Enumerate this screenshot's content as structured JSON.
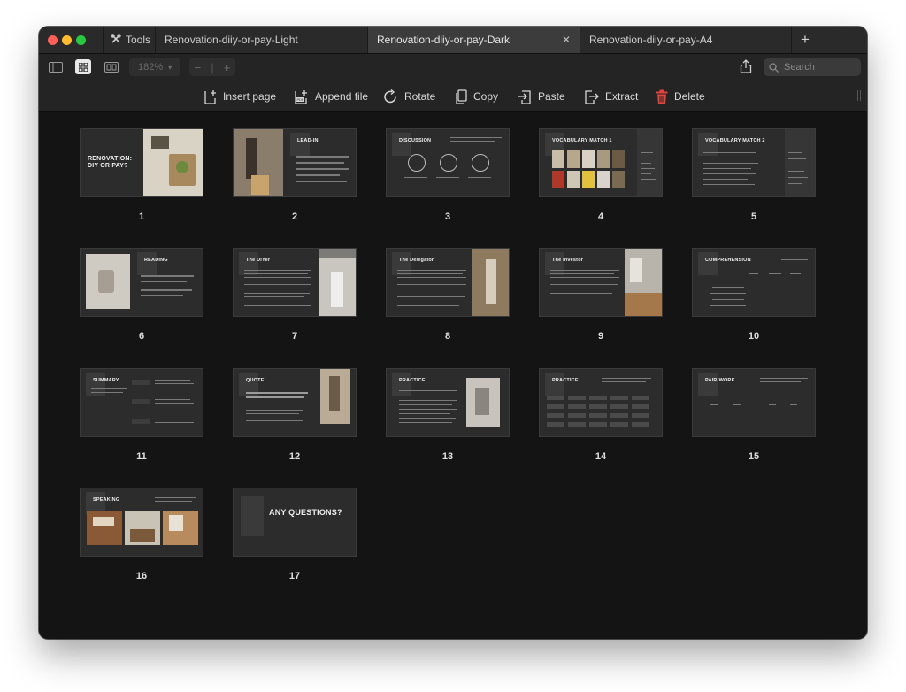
{
  "tabs": {
    "tools_label": "Tools",
    "items": [
      {
        "label": "Renovation-diiy-or-pay-Light"
      },
      {
        "label": "Renovation-diiy-or-pay-Dark"
      },
      {
        "label": "Renovation-diiy-or-pay-A4"
      }
    ],
    "close_glyph": "✕",
    "new_tab_glyph": "+"
  },
  "toolbar": {
    "zoom": "182%",
    "zoom_minus": "−",
    "zoom_plus": "+",
    "search_placeholder": "Search"
  },
  "actions": [
    {
      "label": "Insert page",
      "icon": "insert-page-icon"
    },
    {
      "label": "Append file",
      "icon": "append-pdf-icon"
    },
    {
      "label": "Rotate",
      "icon": "rotate-icon"
    },
    {
      "label": "Copy",
      "icon": "copy-icon"
    },
    {
      "label": "Paste",
      "icon": "paste-icon"
    },
    {
      "label": "Extract",
      "icon": "extract-icon"
    },
    {
      "label": "Delete",
      "icon": "trash-icon"
    }
  ],
  "colors": {
    "delete_icon": "#e0443c",
    "traffic_red": "#ff5f57",
    "traffic_yellow": "#febc2e",
    "traffic_green": "#28c840"
  },
  "pages": [
    {
      "number": "1",
      "title": "RENOVATION:\nDIY OR PAY?"
    },
    {
      "number": "2",
      "title": "LEAD-IN"
    },
    {
      "number": "3",
      "title": "DISCUSSION"
    },
    {
      "number": "4",
      "title": "VOCABULARY MATCH 1"
    },
    {
      "number": "5",
      "title": "VOCABULARY MATCH 2"
    },
    {
      "number": "6",
      "title": "READING"
    },
    {
      "number": "7",
      "title": "The DIYer"
    },
    {
      "number": "8",
      "title": "The Delegator"
    },
    {
      "number": "9",
      "title": "The Investor"
    },
    {
      "number": "10",
      "title": "COMPREHENSION"
    },
    {
      "number": "11",
      "title": "SUMMARY"
    },
    {
      "number": "12",
      "title": "QUOTE"
    },
    {
      "number": "13",
      "title": "PRACTICE"
    },
    {
      "number": "14",
      "title": "PRACTICE"
    },
    {
      "number": "15",
      "title": "PAIR-WORK"
    },
    {
      "number": "16",
      "title": "SPEAKING"
    },
    {
      "number": "17",
      "title": "ANY QUESTIONS?"
    }
  ]
}
